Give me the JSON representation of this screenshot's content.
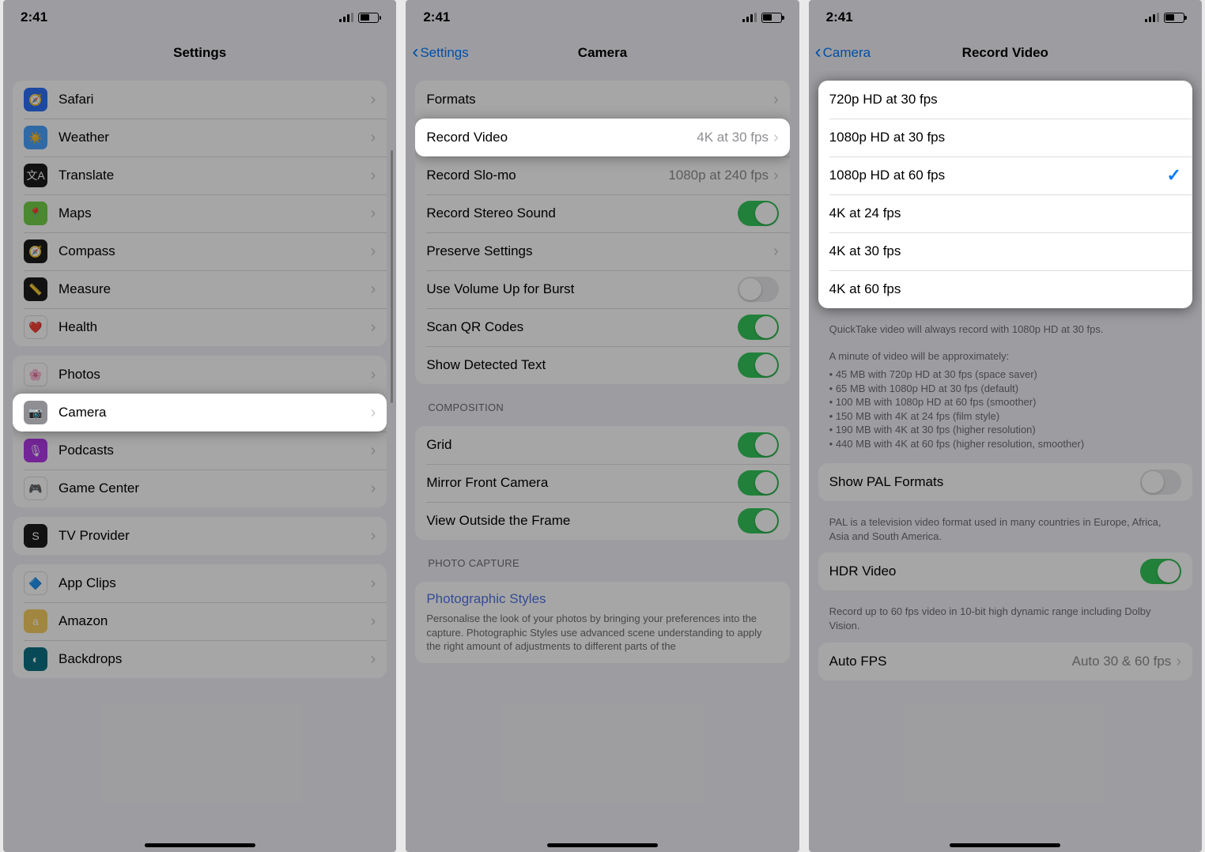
{
  "statusBar": {
    "time": "2:41"
  },
  "phone1": {
    "title": "Settings",
    "rows1": [
      {
        "icon": "safari-icon",
        "bg": "#2f70f8",
        "glyph": "🧭",
        "label": "Safari"
      },
      {
        "icon": "weather-icon",
        "bg": "#4aa3ff",
        "glyph": "☀️",
        "label": "Weather"
      },
      {
        "icon": "translate-icon",
        "bg": "#1c1c1e",
        "glyph": "文A",
        "label": "Translate"
      },
      {
        "icon": "maps-icon",
        "bg": "#73d14b",
        "glyph": "📍",
        "label": "Maps"
      },
      {
        "icon": "compass-icon",
        "bg": "#1c1c1e",
        "glyph": "🧭",
        "label": "Compass"
      },
      {
        "icon": "measure-icon",
        "bg": "#1c1c1e",
        "glyph": "📏",
        "label": "Measure"
      },
      {
        "icon": "health-icon",
        "bg": "#ffffff",
        "glyph": "❤️",
        "label": "Health"
      }
    ],
    "rows2": [
      {
        "icon": "photos-icon",
        "bg": "#ffffff",
        "glyph": "🌸",
        "label": "Photos"
      },
      {
        "icon": "camera-icon",
        "bg": "#8e8e93",
        "glyph": "📷",
        "label": "Camera",
        "highlight": true
      },
      {
        "icon": "podcasts-icon",
        "bg": "#b139e9",
        "glyph": "🎙",
        "label": "Podcasts"
      },
      {
        "icon": "gamecenter-icon",
        "bg": "#ffffff",
        "glyph": "🎮",
        "label": "Game Center"
      }
    ],
    "rows3": [
      {
        "icon": "tvprovider-icon",
        "bg": "#1c1c1e",
        "glyph": "S",
        "label": "TV Provider"
      }
    ],
    "rows4": [
      {
        "icon": "appclips-icon",
        "bg": "#ffffff",
        "glyph": "🔷",
        "label": "App Clips"
      },
      {
        "icon": "amazon-icon",
        "bg": "#f7ce63",
        "glyph": "a",
        "label": "Amazon"
      },
      {
        "icon": "backdrops-icon",
        "bg": "#0b7285",
        "glyph": "◐",
        "label": "Backdrops"
      }
    ]
  },
  "phone2": {
    "back": "Settings",
    "title": "Camera",
    "group1": [
      {
        "label": "Formats",
        "kind": "nav"
      },
      {
        "label": "Record Video",
        "detail": "4K at 30 fps",
        "kind": "nav",
        "highlight": true
      },
      {
        "label": "Record Slo-mo",
        "detail": "1080p at 240 fps",
        "kind": "nav"
      },
      {
        "label": "Record Stereo Sound",
        "kind": "toggle",
        "on": true
      },
      {
        "label": "Preserve Settings",
        "kind": "nav"
      },
      {
        "label": "Use Volume Up for Burst",
        "kind": "toggle",
        "on": false
      },
      {
        "label": "Scan QR Codes",
        "kind": "toggle",
        "on": true
      },
      {
        "label": "Show Detected Text",
        "kind": "toggle",
        "on": true
      }
    ],
    "section2Header": "COMPOSITION",
    "group2": [
      {
        "label": "Grid",
        "kind": "toggle",
        "on": true
      },
      {
        "label": "Mirror Front Camera",
        "kind": "toggle",
        "on": true
      },
      {
        "label": "View Outside the Frame",
        "kind": "toggle",
        "on": true
      }
    ],
    "section3Header": "PHOTO CAPTURE",
    "group3Link": "Photographic Styles",
    "group3Footer": "Personalise the look of your photos by bringing your preferences into the capture. Photographic Styles use advanced scene understanding to apply the right amount of adjustments to different parts of the"
  },
  "phone3": {
    "back": "Camera",
    "title": "Record Video",
    "options": [
      {
        "label": "720p HD at 30 fps"
      },
      {
        "label": "1080p HD at 30 fps"
      },
      {
        "label": "1080p HD at 60 fps",
        "selected": true
      },
      {
        "label": "4K at 24 fps"
      },
      {
        "label": "4K at 30 fps"
      },
      {
        "label": "4K at 60 fps"
      }
    ],
    "footer1a": "QuickTake video will always record with 1080p HD at 30 fps.",
    "footer1b": "A minute of video will be approximately:",
    "footer1bullets": [
      "45 MB with 720p HD at 30 fps (space saver)",
      "65 MB with 1080p HD at 30 fps (default)",
      "100 MB with 1080p HD at 60 fps (smoother)",
      "150 MB with 4K at 24 fps (film style)",
      "190 MB with 4K at 30 fps (higher resolution)",
      "440 MB with 4K at 60 fps (higher resolution, smoother)"
    ],
    "palRow": {
      "label": "Show PAL Formats",
      "on": false
    },
    "palFooter": "PAL is a television video format used in many countries in Europe, Africa, Asia and South America.",
    "hdrRow": {
      "label": "HDR Video",
      "on": true
    },
    "hdrFooter": "Record up to 60 fps video in 10-bit high dynamic range including Dolby Vision.",
    "autoFpsRow": {
      "label": "Auto FPS",
      "detail": "Auto 30 & 60 fps"
    }
  }
}
